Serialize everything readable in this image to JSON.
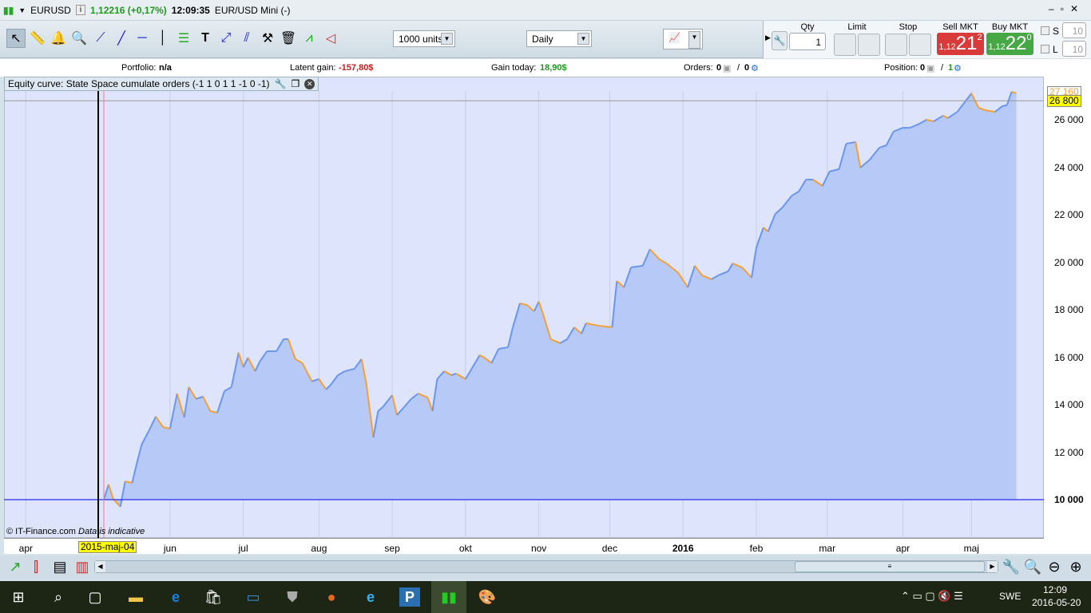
{
  "titlebar": {
    "symbol": "EURUSD",
    "price": "1,12216 (+0,17%)",
    "time": "12:09:35",
    "instrument": "EUR/USD Mini (-)"
  },
  "toolbar": {
    "units": "1000 units",
    "period": "Daily"
  },
  "trade": {
    "qty_label": "Qty",
    "qty_value": "1",
    "limit_label": "Limit",
    "stop_label": "Stop",
    "sell_label": "Sell MKT",
    "buy_label": "Buy MKT",
    "sell_small": "1,12",
    "sell_big": "21",
    "sell_sup": "2",
    "buy_small": "1,12",
    "buy_big": "22",
    "buy_sup": "0",
    "s_label": "S",
    "l_label": "L",
    "s_value": "10",
    "l_value": "10"
  },
  "info": {
    "portfolio_label": "Portfolio:",
    "portfolio": "n/a",
    "latent_label": "Latent gain:",
    "latent": "-157,80$",
    "gain_label": "Gain today:",
    "gain": "18,90$",
    "orders_label": "Orders:",
    "orders_a": "0",
    "orders_b": "0",
    "position_label": "Position:",
    "position_a": "0",
    "position_b": "1"
  },
  "legend": "Equity curve: State Space cumulate orders (-1 1 0 1 1 -1 0 -1)",
  "watermark": {
    "copyright": "© IT-Finance.com",
    "note": "Data is indicative"
  },
  "colors": {
    "fill": "#b7c9f6",
    "up": "#6a96ee",
    "down": "#f3a035",
    "baseline": "#2a2af0"
  },
  "chart_data": {
    "type": "area",
    "start_date": "2015-maj-04",
    "x_unit": "days since start",
    "xlim": [
      -42,
      395
    ],
    "ylim": [
      8500,
      28500
    ],
    "baseline": 10000,
    "cursor_label": "2015-maj-04",
    "last_value_label": "27 160",
    "marker_value_label": "26 800",
    "marker_value": 26800,
    "last_value": 27160,
    "x_ticks": [
      {
        "d": -33,
        "label": "apr"
      },
      {
        "d": 28,
        "label": "jun"
      },
      {
        "d": 59,
        "label": "jul"
      },
      {
        "d": 91,
        "label": "aug"
      },
      {
        "d": 122,
        "label": "sep"
      },
      {
        "d": 153,
        "label": "okt"
      },
      {
        "d": 184,
        "label": "nov"
      },
      {
        "d": 214,
        "label": "dec"
      },
      {
        "d": 245,
        "label": "2016"
      },
      {
        "d": 276,
        "label": "feb"
      },
      {
        "d": 306,
        "label": "mar"
      },
      {
        "d": 338,
        "label": "apr"
      },
      {
        "d": 367,
        "label": "maj"
      }
    ],
    "y_ticks": [
      {
        "v": 10000,
        "label": "10 000"
      },
      {
        "v": 12000,
        "label": "12 000"
      },
      {
        "v": 14000,
        "label": "14 000"
      },
      {
        "v": 16000,
        "label": "16 000"
      },
      {
        "v": 18000,
        "label": "18 000"
      },
      {
        "v": 20000,
        "label": "20 000"
      },
      {
        "v": 22000,
        "label": "22 000"
      },
      {
        "v": 24000,
        "label": "24 000"
      },
      {
        "v": 26000,
        "label": "26 000"
      }
    ],
    "points": [
      [
        0,
        10000
      ],
      [
        2,
        10640
      ],
      [
        4,
        10030
      ],
      [
        7,
        9700
      ],
      [
        9,
        10770
      ],
      [
        12,
        10710
      ],
      [
        14,
        11550
      ],
      [
        16,
        12320
      ],
      [
        19,
        12890
      ],
      [
        22,
        13500
      ],
      [
        25,
        13060
      ],
      [
        28,
        12990
      ],
      [
        31,
        14470
      ],
      [
        34,
        13460
      ],
      [
        36,
        14740
      ],
      [
        39,
        14240
      ],
      [
        42,
        14340
      ],
      [
        45,
        13730
      ],
      [
        48,
        13660
      ],
      [
        51,
        14570
      ],
      [
        54,
        14740
      ],
      [
        57,
        16190
      ],
      [
        59,
        15580
      ],
      [
        61,
        15980
      ],
      [
        64,
        15410
      ],
      [
        66,
        15820
      ],
      [
        69,
        16250
      ],
      [
        73,
        16250
      ],
      [
        76,
        16760
      ],
      [
        78,
        16760
      ],
      [
        81,
        15920
      ],
      [
        84,
        15750
      ],
      [
        88,
        14980
      ],
      [
        91,
        15080
      ],
      [
        94,
        14640
      ],
      [
        96,
        14840
      ],
      [
        99,
        15240
      ],
      [
        102,
        15410
      ],
      [
        106,
        15510
      ],
      [
        109,
        15920
      ],
      [
        111,
        14910
      ],
      [
        114,
        12620
      ],
      [
        116,
        13730
      ],
      [
        118,
        13900
      ],
      [
        122,
        14400
      ],
      [
        124,
        13560
      ],
      [
        127,
        13900
      ],
      [
        130,
        14240
      ],
      [
        133,
        14470
      ],
      [
        137,
        14300
      ],
      [
        139,
        13730
      ],
      [
        141,
        15080
      ],
      [
        144,
        15410
      ],
      [
        147,
        15240
      ],
      [
        149,
        15310
      ],
      [
        153,
        15080
      ],
      [
        155,
        15410
      ],
      [
        159,
        16090
      ],
      [
        161,
        15980
      ],
      [
        164,
        15750
      ],
      [
        167,
        16350
      ],
      [
        171,
        16420
      ],
      [
        173,
        17260
      ],
      [
        176,
        18270
      ],
      [
        179,
        18200
      ],
      [
        182,
        17930
      ],
      [
        184,
        18340
      ],
      [
        186,
        17760
      ],
      [
        189,
        16760
      ],
      [
        193,
        16590
      ],
      [
        196,
        16760
      ],
      [
        199,
        17260
      ],
      [
        202,
        16990
      ],
      [
        204,
        17430
      ],
      [
        209,
        17330
      ],
      [
        215,
        17260
      ],
      [
        217,
        19210
      ],
      [
        220,
        18940
      ],
      [
        223,
        19780
      ],
      [
        228,
        19850
      ],
      [
        231,
        20550
      ],
      [
        235,
        20120
      ],
      [
        238,
        19950
      ],
      [
        243,
        19550
      ],
      [
        247,
        18940
      ],
      [
        250,
        19850
      ],
      [
        253,
        19450
      ],
      [
        257,
        19280
      ],
      [
        260,
        19450
      ],
      [
        264,
        19610
      ],
      [
        266,
        19950
      ],
      [
        270,
        19780
      ],
      [
        274,
        19350
      ],
      [
        276,
        20620
      ],
      [
        279,
        21460
      ],
      [
        281,
        21290
      ],
      [
        284,
        22030
      ],
      [
        287,
        22300
      ],
      [
        291,
        22800
      ],
      [
        294,
        22980
      ],
      [
        297,
        23480
      ],
      [
        300,
        23480
      ],
      [
        304,
        23210
      ],
      [
        307,
        23820
      ],
      [
        311,
        23920
      ],
      [
        314,
        24990
      ],
      [
        318,
        25060
      ],
      [
        320,
        23980
      ],
      [
        324,
        24320
      ],
      [
        328,
        24820
      ],
      [
        331,
        24920
      ],
      [
        334,
        25500
      ],
      [
        338,
        25660
      ],
      [
        341,
        25660
      ],
      [
        345,
        25830
      ],
      [
        348,
        26000
      ],
      [
        351,
        25930
      ],
      [
        355,
        26170
      ],
      [
        357,
        26070
      ],
      [
        361,
        26330
      ],
      [
        367,
        27110
      ],
      [
        370,
        26500
      ],
      [
        373,
        26400
      ],
      [
        377,
        26330
      ],
      [
        380,
        26570
      ],
      [
        382,
        26610
      ],
      [
        384,
        27180
      ],
      [
        386,
        27110
      ]
    ]
  },
  "taskbar": {
    "time": "12:09",
    "date": "2016-05-20",
    "lang": "SWE"
  }
}
